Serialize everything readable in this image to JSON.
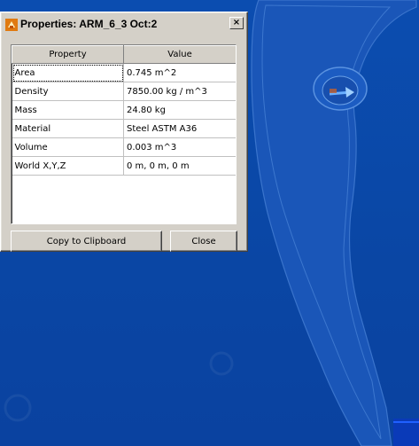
{
  "dialog": {
    "title": "Properties: ARM_6_3 Oct:2",
    "close_glyph": "×",
    "table": {
      "headers": [
        "Property",
        "Value"
      ],
      "rows": [
        [
          "Area",
          "0.745 m^2"
        ],
        [
          "Density",
          "7850.00 kg / m^3"
        ],
        [
          "Mass",
          "24.80 kg"
        ],
        [
          "Material",
          "Steel ASTM A36"
        ],
        [
          "Volume",
          "0.003 m^3"
        ],
        [
          "World X,Y,Z",
          "0 m, 0 m, 0 m"
        ]
      ]
    },
    "buttons": {
      "copy_label": "Copy to Clipboard",
      "close_label": "Close"
    }
  },
  "colors": {
    "viewport_background": "#0a4aa8",
    "part_fill": "#1a56b8",
    "dialog_face": "#d4d0c8"
  },
  "icons": {
    "app_icon": "cad-app-icon",
    "close_icon": "close-icon",
    "axis_marker": "axis-arrow-icon"
  }
}
